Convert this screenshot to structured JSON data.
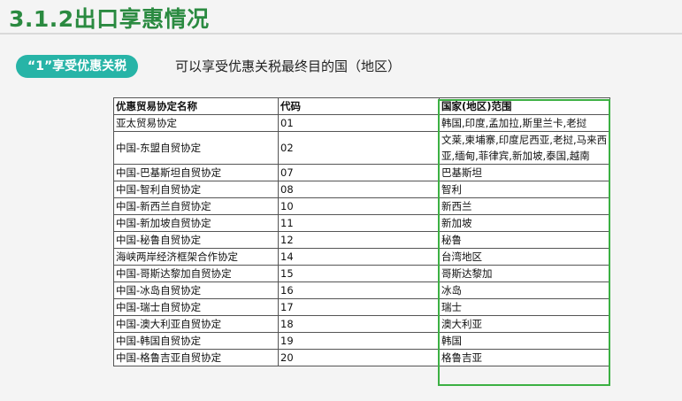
{
  "slide": {
    "title": "3.1.2出口享惠情况",
    "pill_label": "“1”享受优惠关税",
    "pill_description": "可以享受优惠关税最终目的国（地区）"
  },
  "table": {
    "headers": [
      "优惠贸易协定名称",
      "代码",
      "国家(地区)范围"
    ],
    "rows": [
      [
        "亚太贸易协定",
        "01",
        "韩国,印度,孟加拉,斯里兰卡,老挝"
      ],
      [
        "中国-东盟自贸协定",
        "02",
        "文莱,柬埔寨,印度尼西亚,老挝,马来西亚,缅甸,菲律宾,新加坡,泰国,越南"
      ],
      [
        "中国-巴基斯坦自贸协定",
        "07",
        "巴基斯坦"
      ],
      [
        "中国-智利自贸协定",
        "08",
        "智利"
      ],
      [
        "中国-新西兰自贸协定",
        "10",
        "新西兰"
      ],
      [
        "中国-新加坡自贸协定",
        "11",
        "新加坡"
      ],
      [
        "中国-秘鲁自贸协定",
        "12",
        "秘鲁"
      ],
      [
        "海峡两岸经济框架合作协定",
        "14",
        "台湾地区"
      ],
      [
        "中国-哥斯达黎加自贸协定",
        "15",
        "哥斯达黎加"
      ],
      [
        "中国-冰岛自贸协定",
        "16",
        "冰岛"
      ],
      [
        "中国-瑞士自贸协定",
        "17",
        "瑞士"
      ],
      [
        "中国-澳大利亚自贸协定",
        "18",
        "澳大利亚"
      ],
      [
        "中国-韩国自贸协定",
        "19",
        "韩国"
      ],
      [
        "中国-格鲁吉亚自贸协定",
        "20",
        "格鲁吉亚"
      ]
    ]
  },
  "colors": {
    "title": "#2a8a40",
    "pill_bg": "#27b4a7",
    "highlight_border": "#3cb043"
  }
}
